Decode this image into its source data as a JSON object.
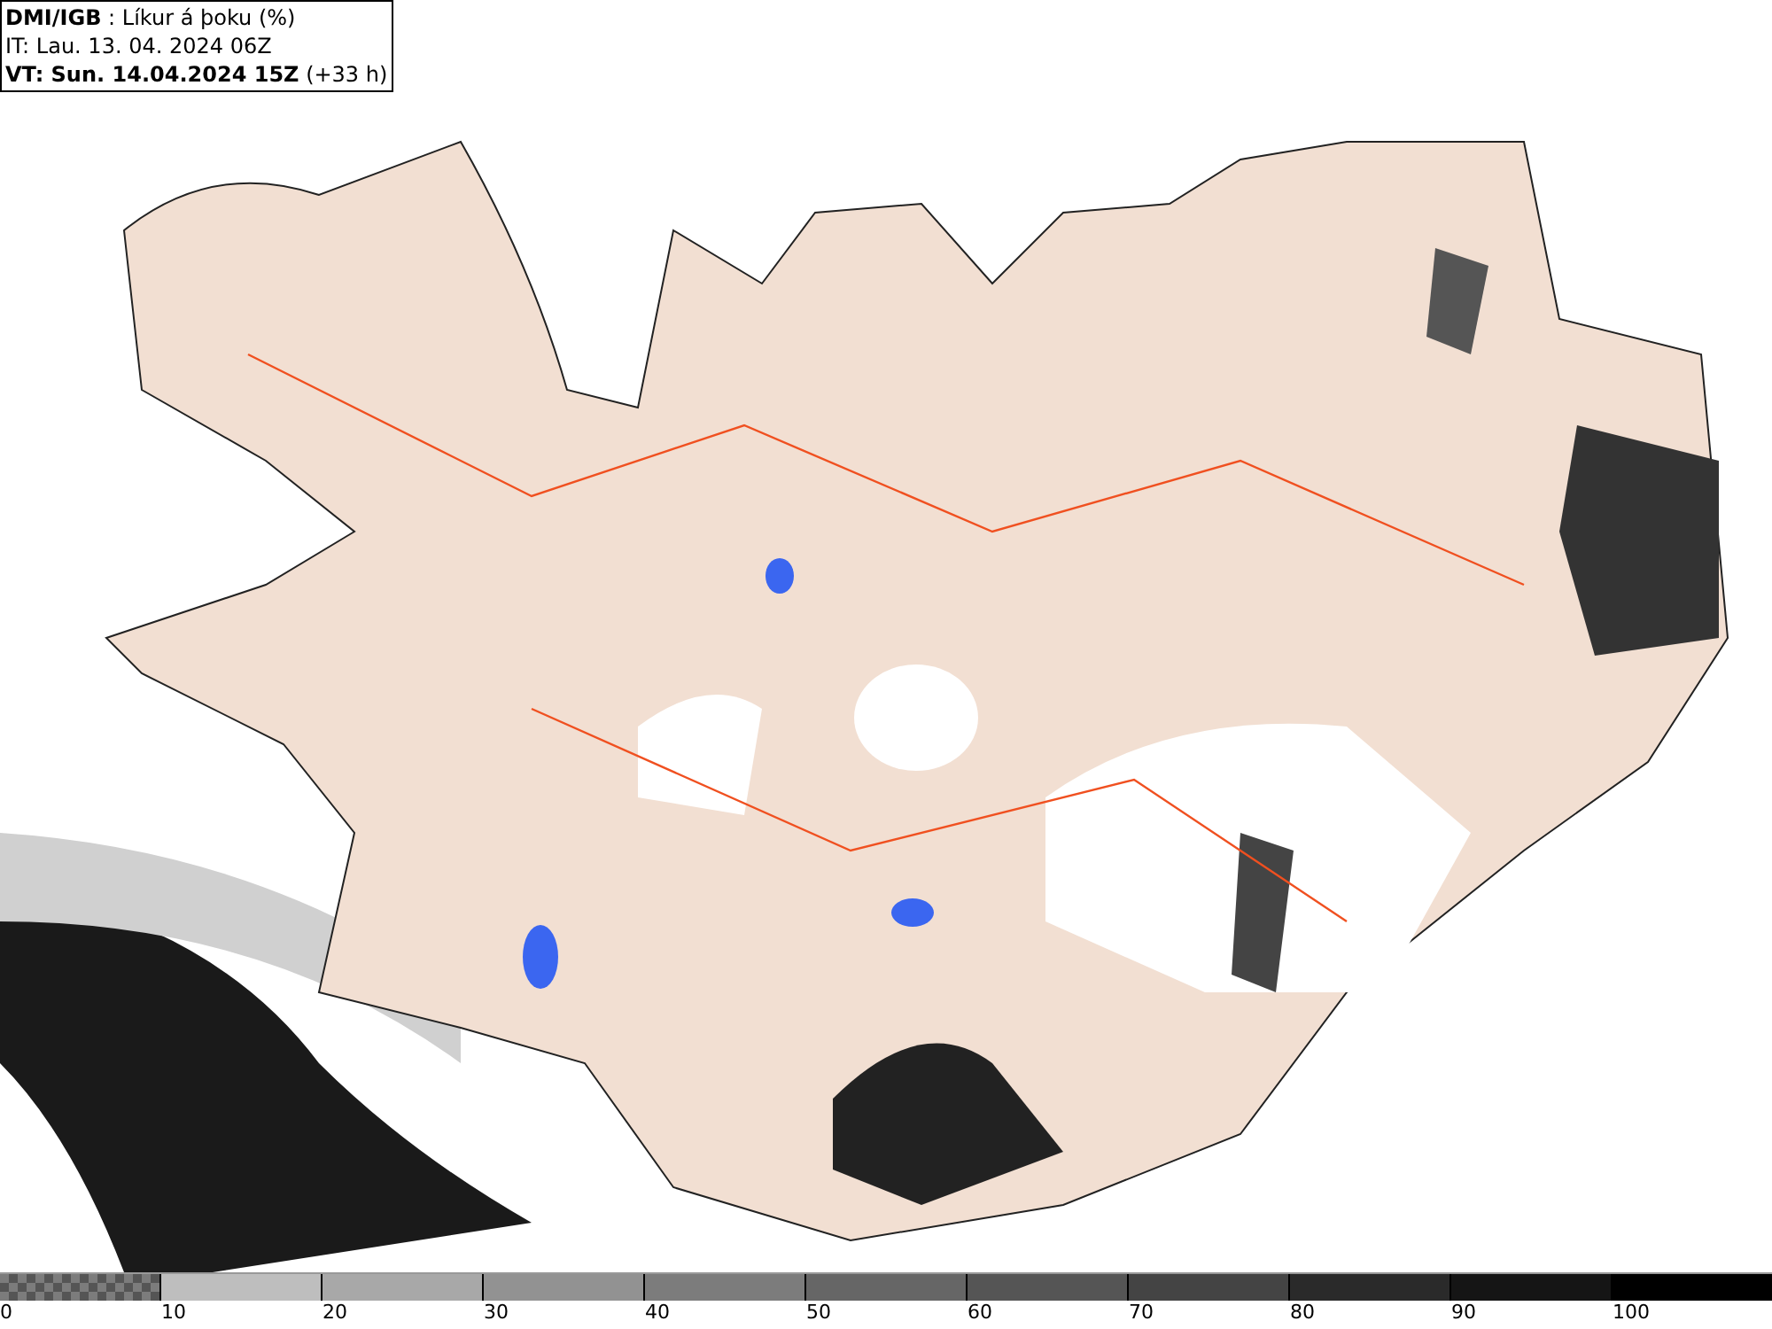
{
  "header": {
    "title": "**DMI/IGB** : Líkur á þoku (%)",
    "issued": "IT: Lau. 13. 04. 2024 06Z",
    "valid": "**VT: Sun. 14.04.2024 15Z** (+33 h)"
  },
  "legend": [
    {
      "label": "0",
      "kind": "pattern",
      "color": "#7c7c7c"
    },
    {
      "label": "10",
      "kind": "solid",
      "color": "#bebebe"
    },
    {
      "label": "20",
      "kind": "solid",
      "color": "#a8a8a8"
    },
    {
      "label": "30",
      "kind": "solid",
      "color": "#929292"
    },
    {
      "label": "40",
      "kind": "solid",
      "color": "#7c7c7c"
    },
    {
      "label": "50",
      "kind": "solid",
      "color": "#666666"
    },
    {
      "label": "60",
      "kind": "solid",
      "color": "#555555"
    },
    {
      "label": "70",
      "kind": "solid",
      "color": "#444444"
    },
    {
      "label": "80",
      "kind": "solid",
      "color": "#2a2a2a"
    },
    {
      "label": "90",
      "kind": "solid",
      "color": "#151515"
    },
    {
      "label": "100",
      "kind": "solid",
      "color": "#000000"
    }
  ]
}
